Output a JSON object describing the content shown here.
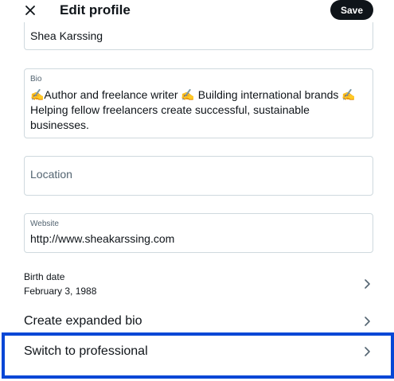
{
  "header": {
    "title": "Edit profile",
    "save_label": "Save",
    "close_icon": "close-icon"
  },
  "fields": {
    "name": {
      "value": "Shea Karssing"
    },
    "bio": {
      "label": "Bio",
      "lines": [
        "✍️Author and freelance writer ✍️ Building international brands ✍️",
        "Helping fellow freelancers create successful, sustainable",
        "businesses."
      ]
    },
    "location": {
      "placeholder": "Location"
    },
    "website": {
      "label": "Website",
      "value": "http://www.sheakarssing.com"
    }
  },
  "rows": {
    "birth_date": {
      "label": "Birth date",
      "value": "February 3, 1988"
    },
    "expanded_bio": {
      "label": "Create expanded bio"
    },
    "professional": {
      "label": "Switch to professional"
    }
  },
  "colors": {
    "text": "#0f1419",
    "muted": "#536471",
    "border": "#cfd9de",
    "highlight": "#0747d6",
    "button": "#0f1419"
  }
}
